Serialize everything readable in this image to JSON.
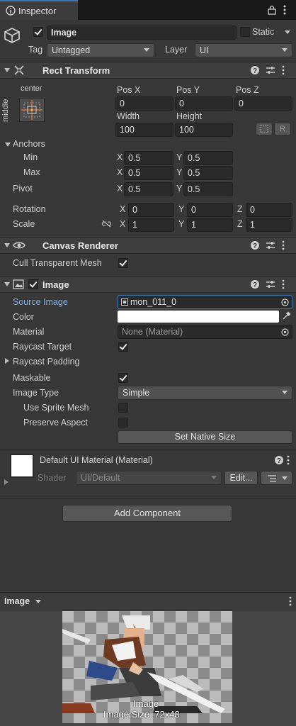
{
  "tab": {
    "label": "Inspector"
  },
  "object": {
    "name": "Image",
    "static_label": "Static",
    "tag_label": "Tag",
    "tag_value": "Untagged",
    "layer_label": "Layer",
    "layer_value": "UI"
  },
  "rect_transform": {
    "title": "Rect Transform",
    "anchor_preset_h": "center",
    "anchor_preset_v": "middle",
    "pos_x_label": "Pos X",
    "pos_y_label": "Pos Y",
    "pos_z_label": "Pos Z",
    "pos_x": "0",
    "pos_y": "0",
    "pos_z": "0",
    "width_label": "Width",
    "height_label": "Height",
    "width": "100",
    "height": "100",
    "r_button": "R",
    "anchors_label": "Anchors",
    "min_label": "Min",
    "max_label": "Max",
    "min_x": "0.5",
    "min_y": "0.5",
    "max_x": "0.5",
    "max_y": "0.5",
    "pivot_label": "Pivot",
    "pivot_x": "0.5",
    "pivot_y": "0.5",
    "rotation_label": "Rotation",
    "rot_x": "0",
    "rot_y": "0",
    "rot_z": "0",
    "scale_label": "Scale",
    "scale_x": "1",
    "scale_y": "1",
    "scale_z": "1",
    "x": "X",
    "y": "Y",
    "z": "Z"
  },
  "canvas_renderer": {
    "title": "Canvas Renderer",
    "cull_label": "Cull Transparent Mesh"
  },
  "image": {
    "title": "Image",
    "source_label": "Source Image",
    "source_value": "mon_011_0",
    "color_label": "Color",
    "material_label": "Material",
    "material_value": "None (Material)",
    "raycast_target_label": "Raycast Target",
    "raycast_padding_label": "Raycast Padding",
    "maskable_label": "Maskable",
    "image_type_label": "Image Type",
    "image_type_value": "Simple",
    "use_sprite_mesh_label": "Use Sprite Mesh",
    "preserve_aspect_label": "Preserve Aspect",
    "set_native_size": "Set Native Size"
  },
  "material": {
    "title": "Default UI Material (Material)",
    "shader_label": "Shader",
    "shader_value": "UI/Default",
    "edit_button": "Edit..."
  },
  "add_component": "Add Component",
  "preview": {
    "dropdown": "Image",
    "caption": "Image",
    "size_caption": "Image Size: 72x48"
  },
  "colors": {
    "accent": "#3a79bb",
    "label_blue": "#7fb2ec",
    "color_swatch": "#ffffff"
  }
}
